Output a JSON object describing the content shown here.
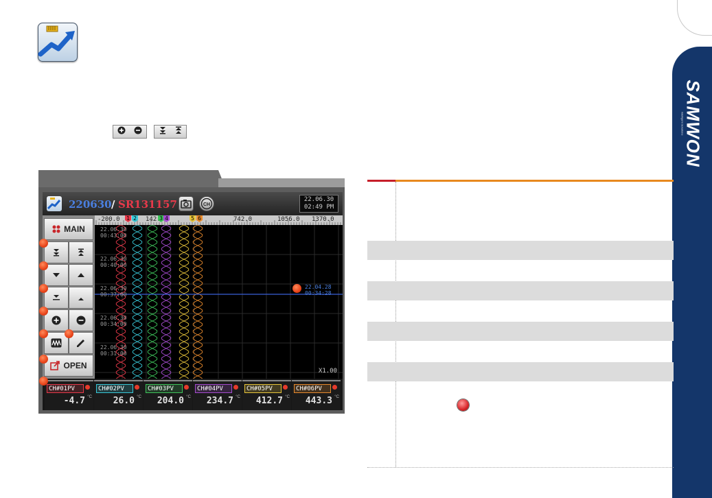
{
  "brand": {
    "name": "SAMWON",
    "subtitle": "Intelligent Solutions"
  },
  "toolbar_hint": {
    "zoom_icons": [
      "zoom-in-icon",
      "zoom-out-icon"
    ],
    "page_icons": [
      "page-down-icon",
      "page-up-icon"
    ]
  },
  "recorder": {
    "title": "220630",
    "separator": "/",
    "serial": "SR131157",
    "clock_date": "22.06.30",
    "clock_time": "02:49 PM",
    "main_label": "MAIN",
    "open_label": "OPEN",
    "scale_labels": [
      "-200.0",
      "142.0",
      "742.0",
      "1056.0",
      "1370.0"
    ],
    "marker_numbers": [
      "1",
      "2",
      "3",
      "4",
      "5",
      "6"
    ],
    "time_labels": [
      {
        "date": "22.06.30",
        "time": "00:43:00"
      },
      {
        "date": "22.06.30",
        "time": "00:40:00"
      },
      {
        "date": "22.06.30",
        "time": "00:37:00"
      },
      {
        "date": "22.06.30",
        "time": "00:34:00"
      },
      {
        "date": "22.06.30",
        "time": "00:31:00"
      }
    ],
    "cursor": {
      "date": "22.04.28",
      "time": "00:34:28"
    },
    "zoom": "X1.00",
    "channels": [
      {
        "tag": "CH#01PV",
        "value": "-4.7",
        "unit": "°C",
        "color": "#e8394a"
      },
      {
        "tag": "CH#02PV",
        "value": "26.0",
        "unit": "°C",
        "color": "#38c8d8"
      },
      {
        "tag": "CH#03PV",
        "value": "204.0",
        "unit": "°C",
        "color": "#3ec45a"
      },
      {
        "tag": "CH#04PV",
        "value": "234.7",
        "unit": "°C",
        "color": "#a54bd0"
      },
      {
        "tag": "CH#05PV",
        "value": "412.7",
        "unit": "°C",
        "color": "#e8c53a"
      },
      {
        "tag": "CH#06PV",
        "value": "443.3",
        "unit": "°C",
        "color": "#e88a2c"
      }
    ]
  },
  "colors": {
    "accent_orange": "#e8891f",
    "accent_red": "#c61f2a",
    "navy": "#14366a",
    "row_shade": "#dcdcdc"
  }
}
